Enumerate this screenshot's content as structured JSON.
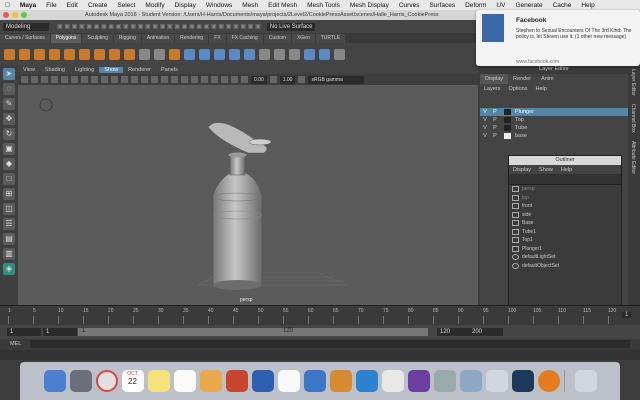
{
  "mac_menu": {
    "apple": "",
    "app_name": "Maya",
    "items": [
      "File",
      "Edit",
      "Create",
      "Select",
      "Modify",
      "Display",
      "Windows",
      "Mesh",
      "Edit Mesh",
      "Mesh Tools",
      "Mesh Display",
      "Curves",
      "Surfaces",
      "Deform",
      "UV",
      "Generate",
      "Cache",
      "Help"
    ]
  },
  "window_title": "Autodesk Maya 2016 - Student Version: /Users/H-Harris/Documents/maya/projects/2Level2/CookiePressAsset/scenes/Halle_Harris_CookiePress",
  "toolbar": {
    "mode": "Modeling",
    "no_live": "No Live Surface",
    "sign_in": "Sign In"
  },
  "shelf_tabs": [
    "Curves / Surfaces",
    "Polygons",
    "Sculpting",
    "Rigging",
    "Animation",
    "Rendering",
    "FX",
    "FX Caching",
    "Custom",
    "XGen",
    "TURTLE"
  ],
  "shelf_active": "Polygons",
  "viewport": {
    "menu": [
      "View",
      "Shading",
      "Lighting",
      "Show",
      "Renderer",
      "Panels"
    ],
    "active_menu": "Show",
    "exposure": "0.00",
    "gamma": "1.00",
    "color_space": "sRGB gamma",
    "camera": "persp"
  },
  "layer_editor": {
    "title": "Layer Editor",
    "tabs": [
      "Display",
      "Render",
      "Anim"
    ],
    "menus": [
      "Layers",
      "Options",
      "Help"
    ],
    "layers": [
      {
        "v": "V",
        "p": "P",
        "name": "Plunger",
        "selected": true
      },
      {
        "v": "V",
        "p": "P",
        "name": "Top",
        "selected": false
      },
      {
        "v": "V",
        "p": "P",
        "name": "Tube",
        "selected": false
      },
      {
        "v": "V",
        "p": "P",
        "name": "base",
        "selected": false
      }
    ]
  },
  "side_tabs": [
    "Layer Editor",
    "Channel Box",
    "Attribute Editor"
  ],
  "outliner": {
    "title": "Outliner",
    "menus": [
      "Display",
      "Show",
      "Help"
    ],
    "items": [
      {
        "name": "persp",
        "dim": true
      },
      {
        "name": "top",
        "dim": true
      },
      {
        "name": "front",
        "dim": false
      },
      {
        "name": "side",
        "dim": false
      },
      {
        "name": "Base",
        "dim": false
      },
      {
        "name": "Tube1",
        "dim": false
      },
      {
        "name": "Top1",
        "dim": false
      },
      {
        "name": "Plunger1",
        "dim": false
      },
      {
        "name": "defaultLightSet",
        "dim": false
      },
      {
        "name": "defaultObjectSet",
        "dim": false
      }
    ]
  },
  "timeline": {
    "ticks": [
      "1",
      "5",
      "10",
      "15",
      "20",
      "25",
      "30",
      "35",
      "40",
      "45",
      "50",
      "55",
      "60",
      "65",
      "70",
      "75",
      "80",
      "85",
      "90",
      "95",
      "100",
      "105",
      "110",
      "115",
      "120"
    ],
    "current_frame": "1",
    "range_start": "1",
    "range_inner_start": "1",
    "range_inner_end": "120",
    "range_end_a": "120",
    "range_end_b": "200"
  },
  "command_line": {
    "label": "MEL"
  },
  "notification": {
    "title": "Facebook",
    "body": "Stephen to Sexual Encounters Of The 3rd Kind: The policy is, let Steven use it. (1 other new message)",
    "footer": "www.facebook.com"
  },
  "dock": {
    "calendar_month": "OCT",
    "calendar_day": "22"
  },
  "colors": {
    "accent": "#5285a6",
    "viewport_bg": "#5b5b5b",
    "shelf_orange": "#c97b2b"
  }
}
